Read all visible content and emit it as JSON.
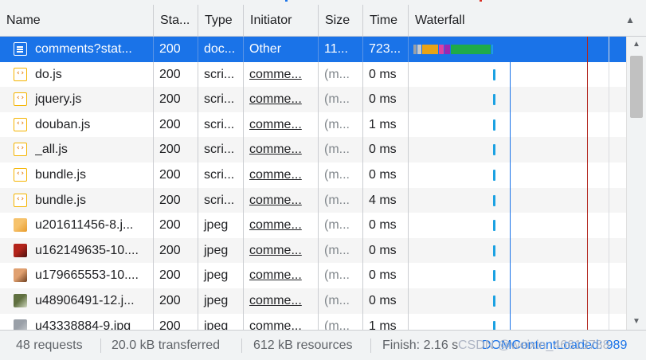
{
  "header": {
    "columns": [
      "Name",
      "Sta...",
      "Type",
      "Initiator",
      "Size",
      "Time",
      "Waterfall"
    ]
  },
  "rows": [
    {
      "name": "comments?stat...",
      "status": "200",
      "type": "doc...",
      "initiator": "Other",
      "size": "11...",
      "time": "723...",
      "icon": "document-icon"
    },
    {
      "name": "do.js",
      "status": "200",
      "type": "scri...",
      "initiator": "comme...",
      "size": "(m...",
      "time": "0 ms",
      "icon": "script-icon"
    },
    {
      "name": "jquery.js",
      "status": "200",
      "type": "scri...",
      "initiator": "comme...",
      "size": "(m...",
      "time": "0 ms",
      "icon": "script-icon"
    },
    {
      "name": "douban.js",
      "status": "200",
      "type": "scri...",
      "initiator": "comme...",
      "size": "(m...",
      "time": "1 ms",
      "icon": "script-icon"
    },
    {
      "name": "_all.js",
      "status": "200",
      "type": "scri...",
      "initiator": "comme...",
      "size": "(m...",
      "time": "0 ms",
      "icon": "script-icon"
    },
    {
      "name": "bundle.js",
      "status": "200",
      "type": "scri...",
      "initiator": "comme...",
      "size": "(m...",
      "time": "0 ms",
      "icon": "script-icon"
    },
    {
      "name": "bundle.js",
      "status": "200",
      "type": "scri...",
      "initiator": "comme...",
      "size": "(m...",
      "time": "4 ms",
      "icon": "script-icon"
    },
    {
      "name": "u201611456-8.j...",
      "status": "200",
      "type": "jpeg",
      "initiator": "comme...",
      "size": "(m...",
      "time": "0 ms",
      "icon": "image-thumbnail-icon"
    },
    {
      "name": "u162149635-10....",
      "status": "200",
      "type": "jpeg",
      "initiator": "comme...",
      "size": "(m...",
      "time": "0 ms",
      "icon": "image-thumbnail-icon"
    },
    {
      "name": "u179665553-10....",
      "status": "200",
      "type": "jpeg",
      "initiator": "comme...",
      "size": "(m...",
      "time": "0 ms",
      "icon": "image-thumbnail-icon"
    },
    {
      "name": "u48906491-12.j...",
      "status": "200",
      "type": "jpeg",
      "initiator": "comme...",
      "size": "(m...",
      "time": "0 ms",
      "icon": "image-thumbnail-icon"
    },
    {
      "name": "u43338884-9.jpg",
      "status": "200",
      "type": "jpeg",
      "initiator": "comme...",
      "size": "(m...",
      "time": "1 ms",
      "icon": "image-thumbnail-icon"
    }
  ],
  "status_bar": {
    "requests": "48 requests",
    "transferred": "20.0 kB transferred",
    "resources": "612 kB resources",
    "finish": "Finish: 2.16 s",
    "dom_content_loaded": "DOMContentLoaded: 989",
    "watermark": "CSDN @weixin_46613788"
  },
  "colors": {
    "selected_row": "#1a73e8",
    "dom_content_loaded_line": "#1a73e8",
    "load_line": "#b3261e",
    "waterfall_tick": "#1ba1e2"
  }
}
